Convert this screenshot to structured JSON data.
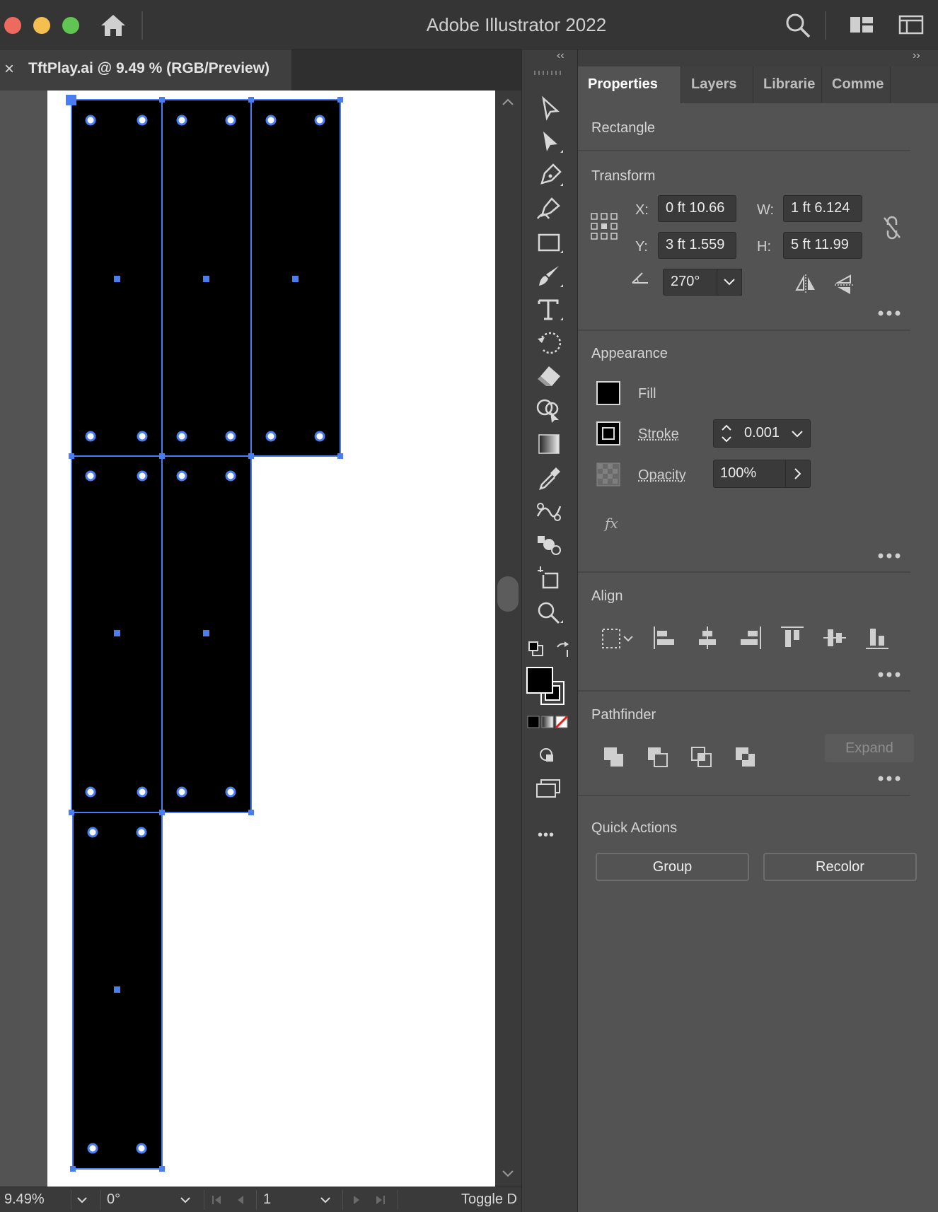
{
  "window": {
    "title": "Adobe Illustrator 2022"
  },
  "document_tab": {
    "close_glyph": "×",
    "title": "TftPlay.ai @ 9.49 % (RGB/Preview)"
  },
  "status_bar": {
    "zoom": "9.49%",
    "rotation": "0°",
    "artboard_number": "1",
    "toggle_label": "Toggle D"
  },
  "panel": {
    "collapse_left": "‹‹",
    "collapse_right": "››",
    "tabs": [
      "Properties",
      "Layers",
      "Librarie",
      "Comme"
    ],
    "active_tab": "Properties",
    "object_type": "Rectangle",
    "transform": {
      "title": "Transform",
      "x_label": "X:",
      "x_value": "0 ft 10.66",
      "y_label": "Y:",
      "y_value": "3 ft 1.559",
      "w_label": "W:",
      "w_value": "1 ft 6.124",
      "h_label": "H:",
      "h_value": "5 ft 11.99",
      "angle_value": "270°"
    },
    "appearance": {
      "title": "Appearance",
      "fill_label": "Fill",
      "stroke_label": "Stroke",
      "stroke_value": "0.001",
      "opacity_label": "Opacity",
      "opacity_value": "100%",
      "fx_label": "fx"
    },
    "align": {
      "title": "Align"
    },
    "pathfinder": {
      "title": "Pathfinder",
      "expand_label": "Expand"
    },
    "quick_actions": {
      "title": "Quick Actions",
      "group_label": "Group",
      "recolor_label": "Recolor"
    }
  },
  "colors": {
    "selection": "#4a7df0",
    "fill": "#000000",
    "artboard": "#ffffff"
  },
  "toolbar": {
    "more_glyph": "•••"
  }
}
